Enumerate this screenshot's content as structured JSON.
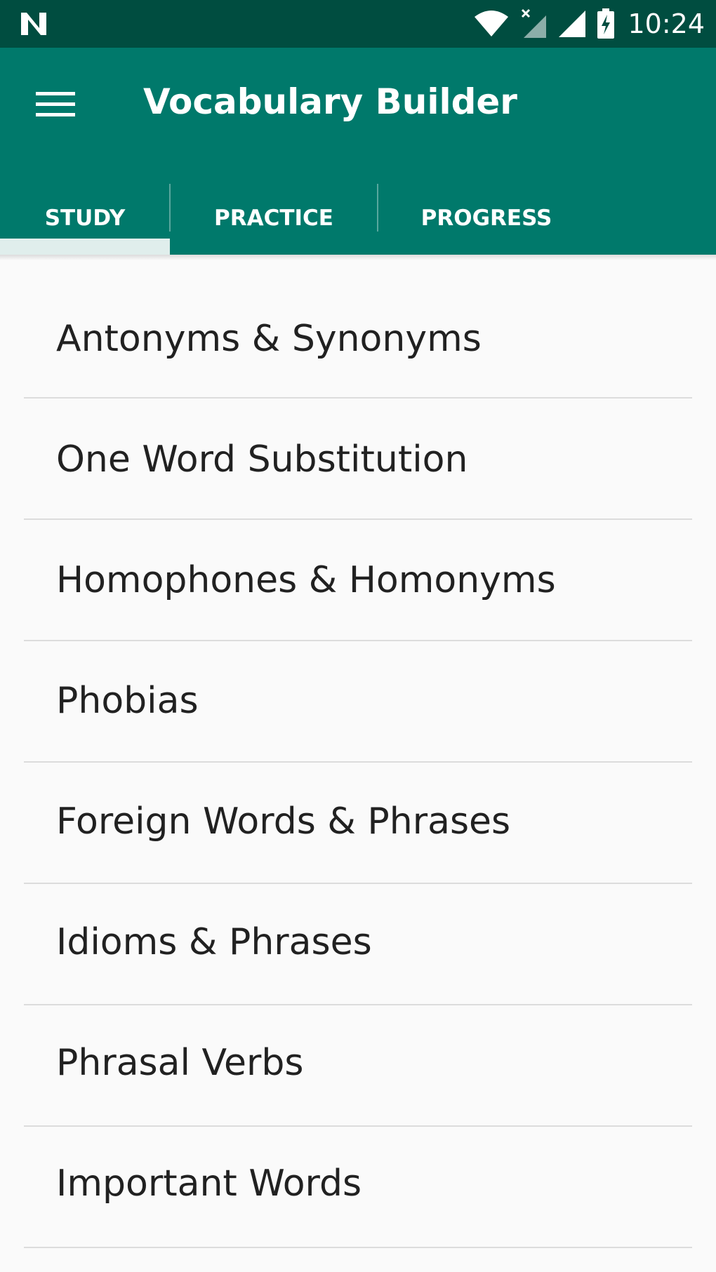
{
  "status_bar": {
    "time": "10:24",
    "icons": [
      "n-logo-icon",
      "wifi-icon",
      "no-signal-icon",
      "signal-icon",
      "battery-charging-icon"
    ]
  },
  "app_bar": {
    "title": "Vocabulary Builder",
    "menu_icon": "menu-icon",
    "background_color": "#00796b",
    "status_color": "#004d40"
  },
  "tabs": [
    {
      "label": "STUDY",
      "selected": true
    },
    {
      "label": "PRACTICE",
      "selected": false
    },
    {
      "label": "PROGRESS",
      "selected": false
    }
  ],
  "topics": [
    {
      "label": "Antonyms & Synonyms"
    },
    {
      "label": "One Word Substitution"
    },
    {
      "label": "Homophones & Homonyms"
    },
    {
      "label": "Phobias"
    },
    {
      "label": "Foreign Words & Phrases"
    },
    {
      "label": "Idioms & Phrases"
    },
    {
      "label": "Phrasal Verbs"
    },
    {
      "label": "Important Words"
    }
  ]
}
